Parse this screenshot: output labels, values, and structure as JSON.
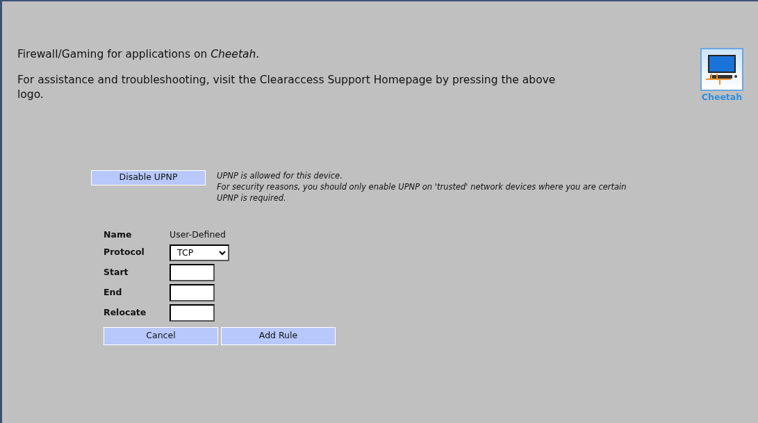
{
  "header": {
    "title": "Firewall/Gaming for applications on *Cheetah*.",
    "help": "For assistance and troubleshooting, visit the Clearaccess Support Homepage by pressing the above logo.",
    "logo_label": "Cheetah"
  },
  "upnp": {
    "button": "Disable UPNP",
    "status": "UPNP is allowed for this device.",
    "warning": "For security reasons, you should only enable UPNP on 'trusted' network devices where you are certain UPNP is required."
  },
  "form": {
    "fields": [
      {
        "kind": "text",
        "label": "Name",
        "value": "User-Defined"
      },
      {
        "kind": "select",
        "label": "Protocol",
        "value": "TCP"
      },
      {
        "kind": "input",
        "label": "Start"
      },
      {
        "kind": "input",
        "label": "End"
      },
      {
        "kind": "input",
        "label": "Relocate"
      }
    ],
    "buttons": [
      "Cancel",
      "Add Rule"
    ]
  }
}
